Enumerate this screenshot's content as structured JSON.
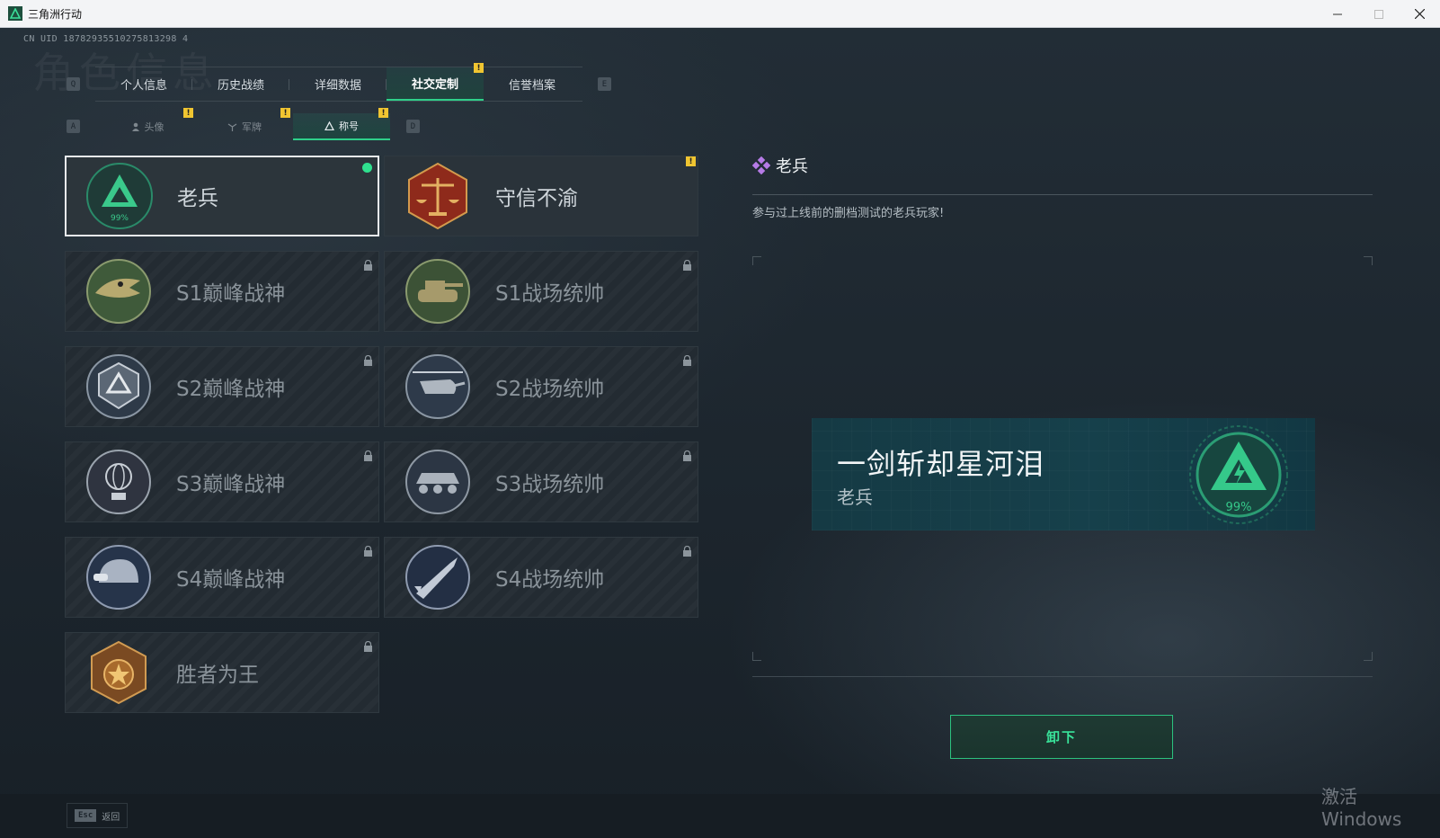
{
  "window": {
    "title": "三角洲行动"
  },
  "uid": "CN UID 18782935510275813298 4",
  "background_title": "角色信息",
  "main_tabs": {
    "prev_key": "Q",
    "next_key": "E",
    "items": [
      {
        "label": "个人信息"
      },
      {
        "label": "历史战绩"
      },
      {
        "label": "详细数据"
      },
      {
        "label": "社交定制"
      },
      {
        "label": "信誉档案"
      }
    ],
    "active_index": 3
  },
  "sub_tabs": {
    "prev_key": "A",
    "next_key": "D",
    "items": [
      {
        "label": "头像"
      },
      {
        "label": "军牌"
      },
      {
        "label": "称号"
      }
    ],
    "active_index": 2
  },
  "titles": [
    {
      "name": "老兵",
      "state": "selected",
      "emblem": "veteran-emblem"
    },
    {
      "name": "守信不渝",
      "state": "unlocked",
      "emblem": "scales-emblem"
    },
    {
      "name": "S1巅峰战神",
      "state": "locked",
      "emblem": "crocodile-emblem"
    },
    {
      "name": "S1战场统帅",
      "state": "locked",
      "emblem": "tank-emblem"
    },
    {
      "name": "S2巅峰战神",
      "state": "locked",
      "emblem": "shield-emblem"
    },
    {
      "name": "S2战场统帅",
      "state": "locked",
      "emblem": "helicopter-emblem"
    },
    {
      "name": "S3巅峰战神",
      "state": "locked",
      "emblem": "globe-emblem"
    },
    {
      "name": "S3战场统帅",
      "state": "locked",
      "emblem": "apc-emblem"
    },
    {
      "name": "S4巅峰战神",
      "state": "locked",
      "emblem": "helmet-emblem"
    },
    {
      "name": "S4战场统帅",
      "state": "locked",
      "emblem": "missile-emblem"
    },
    {
      "name": "胜者为王",
      "state": "locked",
      "emblem": "medal-emblem"
    }
  ],
  "badges": {
    "mark": "!"
  },
  "detail": {
    "title_name": "老兵",
    "description": "参与过上线前的删档测试的老兵玩家!",
    "preview_player_name": "一剑斩却星河泪",
    "preview_title": "老兵",
    "emblem_percent": "99%",
    "unequip_label": "卸下"
  },
  "footer": {
    "esc_key": "Esc",
    "back_label": "返回"
  },
  "watermark": "激活 Windows",
  "colors": {
    "accent_green": "#2fd08a",
    "badge_yellow": "#f0c531",
    "selected_dot": "#2fe08e"
  }
}
